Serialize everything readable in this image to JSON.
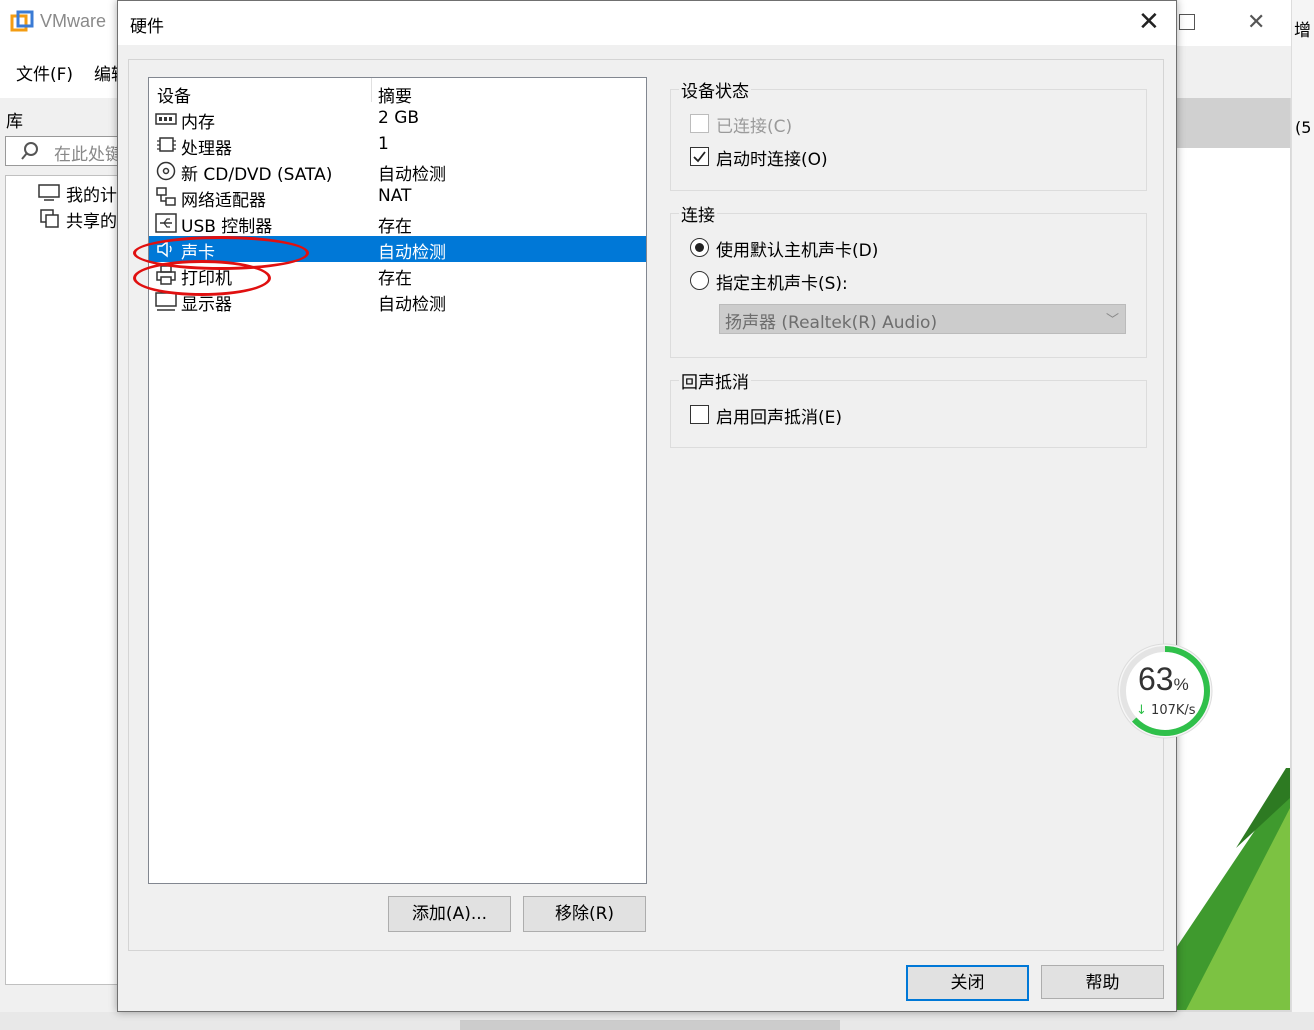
{
  "background_window": {
    "title": "VMware",
    "menu": [
      "文件(F)",
      "编辑"
    ],
    "library_label": "库",
    "search_placeholder": "在此处键",
    "tree_items": [
      "我的计",
      "共享的"
    ],
    "right_edge_text_top": "增",
    "right_edge_text_mid": "(5"
  },
  "dialog": {
    "title": "硬件",
    "device_list": {
      "col_device": "设备",
      "col_summary": "摘要",
      "rows": [
        {
          "name": "内存",
          "summary": "2 GB",
          "icon": "memory-icon"
        },
        {
          "name": "处理器",
          "summary": "1",
          "icon": "cpu-icon"
        },
        {
          "name": "新 CD/DVD (SATA)",
          "summary": "自动检测",
          "icon": "cd-icon"
        },
        {
          "name": "网络适配器",
          "summary": "NAT",
          "icon": "network-icon"
        },
        {
          "name": "USB 控制器",
          "summary": "存在",
          "icon": "usb-icon"
        },
        {
          "name": "声卡",
          "summary": "自动检测",
          "icon": "speaker-icon",
          "selected": true
        },
        {
          "name": "打印机",
          "summary": "存在",
          "icon": "printer-icon"
        },
        {
          "name": "显示器",
          "summary": "自动检测",
          "icon": "monitor-icon"
        }
      ]
    },
    "add_button": "添加(A)...",
    "remove_button": "移除(R)",
    "device_status": {
      "title": "设备状态",
      "connected": {
        "label": "已连接(C)",
        "checked": false,
        "disabled": true
      },
      "connect_at_power_on": {
        "label": "启动时连接(O)",
        "checked": true
      }
    },
    "connection": {
      "title": "连接",
      "use_default": {
        "label": "使用默认主机声卡(D)",
        "selected": true
      },
      "specify": {
        "label": "指定主机声卡(S):",
        "selected": false
      },
      "host_device": "扬声器 (Realtek(R) Audio)"
    },
    "echo_cancel": {
      "title": "回声抵消",
      "enable": {
        "label": "启用回声抵消(E)",
        "checked": false
      }
    },
    "close_button": "关闭",
    "help_button": "帮助"
  },
  "speed_widget": {
    "percent": "63",
    "unit": "%",
    "rate": "107K/s",
    "progress": 0.63
  },
  "colors": {
    "selection": "#0078d7",
    "annotation": "#e01010",
    "speed_ring": "#2fc04a"
  }
}
